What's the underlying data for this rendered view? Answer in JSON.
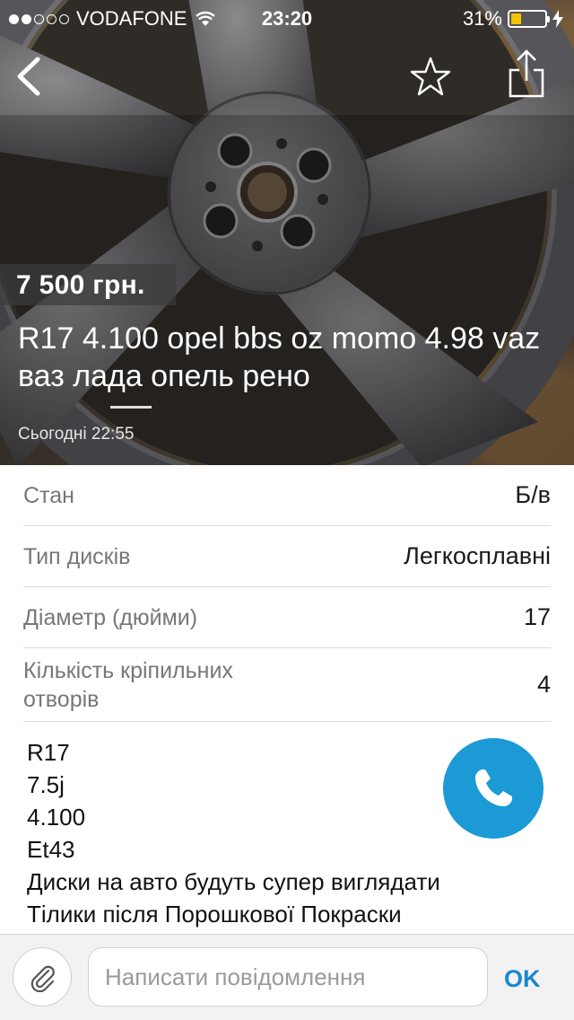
{
  "status_bar": {
    "carrier": "VODAFONE",
    "time": "23:20",
    "battery": "31%",
    "battery_level": 0.31,
    "signal_bars_filled": 2,
    "signal_bars_total": 5
  },
  "listing": {
    "price": "7 500 грн.",
    "title": "R17 4.100 opel bbs oz momo 4.98 vaz ваз лада опель рено",
    "posted": "Сьогодні 22:55"
  },
  "specs": [
    {
      "label": "Стан",
      "value": "Б/в"
    },
    {
      "label": "Тип дисків",
      "value": "Легкосплавні"
    },
    {
      "label": "Діаметр (дюйми)",
      "value": "17"
    },
    {
      "label": "Кількість кріпильних отворів",
      "value": "4"
    }
  ],
  "description": [
    "R17",
    "7.5j",
    "4.100",
    "Et43",
    "Диски на авто будуть супер виглядати",
    "Тілики після Порошкової Покраски"
  ],
  "message_bar": {
    "placeholder": "Написати повідомлення",
    "send_label": "OK"
  },
  "icons": {
    "back": "chevron-left-icon",
    "favorite": "star-outline-icon",
    "share": "share-icon",
    "call": "phone-icon",
    "attach": "paperclip-icon"
  },
  "colors": {
    "accent": "#1b9ad6",
    "link": "#1b88cc",
    "battery": "#f6c400"
  }
}
